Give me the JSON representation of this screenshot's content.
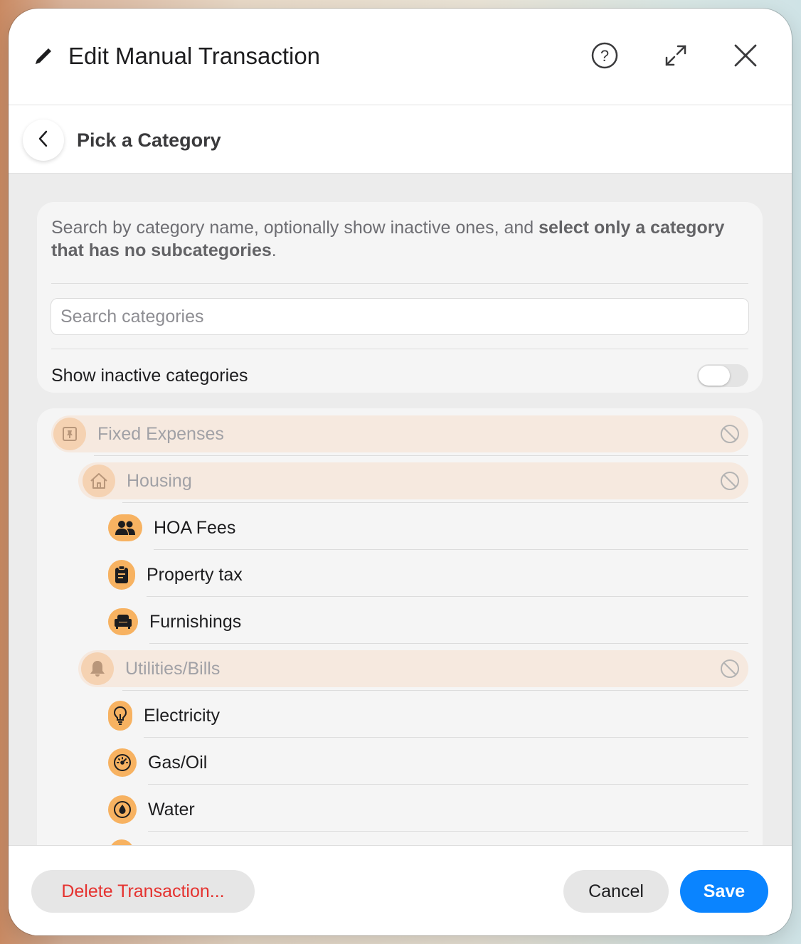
{
  "dialog": {
    "title": "Edit Manual Transaction",
    "subheader_title": "Pick a Category"
  },
  "help": {
    "text_plain": "Search by category name, optionally show inactive ones, and ",
    "text_bold": "select only a category that has no subcategories",
    "text_end": "."
  },
  "search": {
    "placeholder": "Search categories",
    "value": ""
  },
  "toggle": {
    "label": "Show inactive categories",
    "on": false
  },
  "categories": {
    "fixed_expenses": {
      "label": "Fixed Expenses",
      "icon": "pushpin-icon",
      "selectable": false
    },
    "housing": {
      "label": "Housing",
      "icon": "house-icon",
      "selectable": false
    },
    "hoa_fees": {
      "label": "HOA Fees",
      "icon": "people-icon"
    },
    "property_tax": {
      "label": "Property tax",
      "icon": "clipboard-icon"
    },
    "furnishings": {
      "label": "Furnishings",
      "icon": "armchair-icon"
    },
    "utilities": {
      "label": "Utilities/Bills",
      "icon": "bell-icon",
      "selectable": false
    },
    "electricity": {
      "label": "Electricity",
      "icon": "lightbulb-icon"
    },
    "gas_oil": {
      "label": "Gas/Oil",
      "icon": "gauge-icon"
    },
    "water": {
      "label": "Water",
      "icon": "water-drop-icon"
    }
  },
  "footer": {
    "delete_label": "Delete Transaction...",
    "cancel_label": "Cancel",
    "save_label": "Save"
  },
  "colors": {
    "accent": "#0a84ff",
    "danger": "#e5322f",
    "category_orange": "#f7b261",
    "parent_row_bg": "#f6e9df"
  }
}
